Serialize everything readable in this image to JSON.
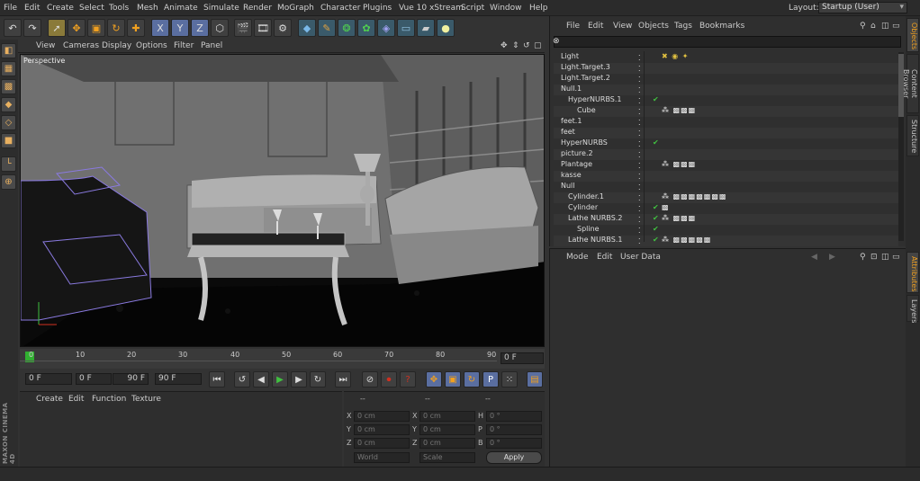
{
  "menubar": {
    "items": [
      "File",
      "Edit",
      "Create",
      "Select",
      "Tools",
      "Mesh",
      "Animate",
      "Simulate",
      "Render",
      "MoGraph",
      "Character",
      "Plugins",
      "Vue 10 xStream",
      "Script",
      "Window",
      "Help"
    ],
    "layout_label": "Layout:",
    "layout_value": "Startup (User)"
  },
  "toolbar": {
    "icons": [
      "undo-icon",
      "redo-icon",
      "live-select-icon",
      "move-icon",
      "scale-icon",
      "rotate-icon",
      "last-tool-icon",
      "x-axis-icon",
      "y-axis-icon",
      "z-axis-icon",
      "world-coordinate-icon",
      "render-view-icon",
      "render-picture-queue-icon",
      "render-settings-icon",
      "cube-icon",
      "pen-icon",
      "nurbs-icon",
      "array-icon",
      "deformer-icon",
      "floor-icon",
      "camera-icon",
      "light-icon"
    ],
    "axis_labels": [
      "X",
      "Y",
      "Z"
    ]
  },
  "viewport": {
    "menu": [
      "View",
      "Cameras",
      "Display",
      "Options",
      "Filter",
      "Panel"
    ],
    "label": "Perspective"
  },
  "timeline": {
    "ticks": [
      "0",
      "10",
      "20",
      "30",
      "40",
      "50",
      "60",
      "70",
      "80",
      "90"
    ],
    "current_frame": "0 F",
    "start_field": "0 F",
    "min_field": "0 F",
    "max_field": "90 F",
    "end_field": "90 F"
  },
  "material_manager": {
    "menu": [
      "Create",
      "Edit",
      "Function",
      "Texture"
    ],
    "logo": "MAXON CINEMA 4D"
  },
  "coordinates": {
    "headers": [
      "--",
      "--",
      "--"
    ],
    "rows": [
      {
        "label": "X",
        "pos": "0 cm",
        "size_label": "X",
        "size": "0 cm",
        "rot_label": "H",
        "rot": "0 °"
      },
      {
        "label": "Y",
        "pos": "0 cm",
        "size_label": "Y",
        "size": "0 cm",
        "rot_label": "P",
        "rot": "0 °"
      },
      {
        "label": "Z",
        "pos": "0 cm",
        "size_label": "Z",
        "size": "0 cm",
        "rot_label": "B",
        "rot": "0 °"
      }
    ],
    "mode_select": "World",
    "scale_select": "Scale",
    "apply_label": "Apply"
  },
  "object_manager": {
    "menu": [
      "File",
      "Edit",
      "View",
      "Objects",
      "Tags",
      "Bookmarks"
    ],
    "objects": [
      {
        "name": "Light",
        "indent": 0,
        "tags": "✖ ◉ ✦",
        "check": ""
      },
      {
        "name": "Light.Target.3",
        "indent": 0,
        "tags": "",
        "check": ""
      },
      {
        "name": "Light.Target.2",
        "indent": 0,
        "tags": "",
        "check": ""
      },
      {
        "name": "Null.1",
        "indent": 0,
        "tags": "",
        "check": ""
      },
      {
        "name": "HyperNURBS.1",
        "indent": 1,
        "tags": "",
        "check": "✔"
      },
      {
        "name": "Cube",
        "indent": 2,
        "tags": "⁂ ▩▩▩",
        "check": ""
      },
      {
        "name": "feet.1",
        "indent": 0,
        "tags": "",
        "check": ""
      },
      {
        "name": "feet",
        "indent": 0,
        "tags": "",
        "check": ""
      },
      {
        "name": "HyperNURBS",
        "indent": 0,
        "tags": "",
        "check": "✔"
      },
      {
        "name": "picture.2",
        "indent": 0,
        "tags": "",
        "check": ""
      },
      {
        "name": "Plantage",
        "indent": 0,
        "tags": "⁂ ▩▩▩",
        "check": ""
      },
      {
        "name": "kasse",
        "indent": 0,
        "tags": "",
        "check": ""
      },
      {
        "name": "Null",
        "indent": 0,
        "tags": "",
        "check": ""
      },
      {
        "name": "Cylinder.1",
        "indent": 1,
        "tags": "⁂ ▩▩▩▩▩▩▩",
        "check": ""
      },
      {
        "name": "Cylinder",
        "indent": 1,
        "tags": "▩",
        "check": "✔"
      },
      {
        "name": "Lathe NURBS.2",
        "indent": 1,
        "tags": "⁂ ▩▩▩",
        "check": "✔"
      },
      {
        "name": "Spline",
        "indent": 2,
        "tags": "",
        "check": "✔"
      },
      {
        "name": "Lathe NURBS.1",
        "indent": 1,
        "tags": "⁂ ▩▩▩▩▩",
        "check": "✔"
      }
    ]
  },
  "attribute_manager": {
    "menu": [
      "Mode",
      "Edit",
      "User Data"
    ]
  },
  "right_tabs": {
    "top": [
      "Objects",
      "Content Browser",
      "Structure"
    ],
    "bottom": [
      "Attributes",
      "Layers"
    ]
  },
  "colors": {
    "accent": "#f0a020",
    "play_green": "#40c040",
    "record_red": "#d03020",
    "selection_purple": "#8a7ae0"
  }
}
